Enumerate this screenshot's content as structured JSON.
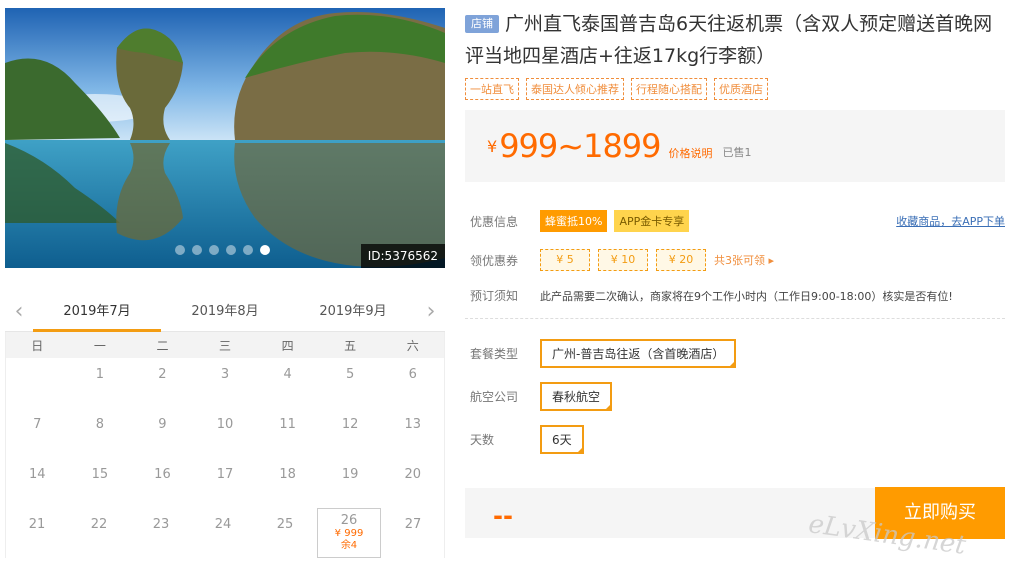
{
  "photo": {
    "id_label": "ID:5376562",
    "dot_count": 6,
    "active_dot": 5
  },
  "calendar": {
    "months": [
      "2019年7月",
      "2019年8月",
      "2019年9月"
    ],
    "weekdays": [
      "日",
      "一",
      "二",
      "三",
      "四",
      "五",
      "六"
    ],
    "weeks": [
      [
        "",
        "1",
        "2",
        "3",
        "4",
        "5",
        "6"
      ],
      [
        "7",
        "8",
        "9",
        "10",
        "11",
        "12",
        "13"
      ],
      [
        "14",
        "15",
        "16",
        "17",
        "18",
        "19",
        "20"
      ],
      [
        "21",
        "22",
        "23",
        "24",
        "25",
        "26",
        "27"
      ]
    ],
    "selected": {
      "day": "26",
      "price": "¥ 999",
      "stock": "余4"
    }
  },
  "product": {
    "shop_badge": "店铺",
    "title": "广州直飞泰国普吉岛6天往返机票（含双人预定赠送首晚网评当地四星酒店+往返17kg行李额）",
    "tags": [
      "一站直飞",
      "泰国达人倾心推荐",
      "行程随心搭配",
      "优质酒店"
    ],
    "price_symbol": "¥",
    "price": "999~1899",
    "price_note": "价格说明",
    "sold": "已售1"
  },
  "promo": {
    "label": "优惠信息",
    "badge1": "蜂蜜抵10%",
    "badge2": "APP金卡专享",
    "fav_link": "收藏商品，去APP下单"
  },
  "coupons": {
    "label": "领优惠券",
    "items": [
      "¥ 5",
      "¥ 10",
      "¥ 20"
    ],
    "more": "共3张可领 ▸"
  },
  "notice": {
    "label": "预订须知",
    "text": "此产品需要二次确认，商家将在9个工作小时内（工作日9:00-18:00）核实是否有位!"
  },
  "options": {
    "package_label": "套餐类型",
    "package_value": "广州-普吉岛往返（含首晚酒店）",
    "airline_label": "航空公司",
    "airline_value": "春秋航空",
    "days_label": "天数",
    "days_value": "6天"
  },
  "buy": {
    "total": "--",
    "button": "立即购买"
  },
  "watermark": "eLvXing.net"
}
